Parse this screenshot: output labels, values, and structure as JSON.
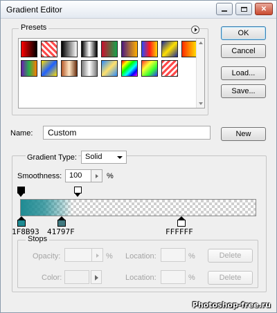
{
  "window": {
    "title": "Gradient Editor"
  },
  "buttons": {
    "ok": "OK",
    "cancel": "Cancel",
    "load": "Load...",
    "save": "Save...",
    "new": "New"
  },
  "presets": {
    "label": "Presets",
    "menu_icon": "right-arrow-circle-icon",
    "swatches": [
      "linear-gradient(90deg,#ff0000,#000000)",
      "repeating-linear-gradient(45deg,#ff4a4a 0 3px,#ffffff 3px 6px)",
      "linear-gradient(90deg,#000000,#ffffff)",
      "linear-gradient(90deg,#000000,#ffffff 50%,#000000)",
      "linear-gradient(90deg,#c8102e,#16a34a)",
      "linear-gradient(90deg,#4b1a7f,#ffb000)",
      "linear-gradient(90deg,#2a4bff,#ff1a1a,#ffd400)",
      "linear-gradient(135deg,#1b2a9a,#ffe000,#1b2a9a)",
      "linear-gradient(90deg,#ff2a00,#ffea00)",
      "linear-gradient(90deg,#6b1ab0,#2ab04b,#ff7a00)",
      "linear-gradient(135deg,#ffe000,#2060ff,#ffe000)",
      "linear-gradient(90deg,#b55a2a,#ffe7c6,#6b2f0f)",
      "linear-gradient(90deg,#7a7a7a,#ffffff,#7a7a7a)",
      "linear-gradient(135deg,#2a8cff,#ffe06a,#2a8cff)",
      "linear-gradient(135deg,#ff0000,#ffff00,#00ff00,#00ffff,#0000ff,#ff00ff)",
      "linear-gradient(135deg,rgba(255,0,0,.8),rgba(255,255,0,.8),rgba(0,255,0,.8),rgba(0,0,255,.8))",
      "repeating-linear-gradient(135deg,#ff4a4a 0 3px,#ffffff 3px 6px)"
    ]
  },
  "name": {
    "label": "Name:",
    "value": "Custom"
  },
  "gradient": {
    "type_label": "Gradient Type:",
    "type_value": "Solid",
    "smoothness_label": "Smoothness:",
    "smoothness_value": "100",
    "smoothness_unit": "%",
    "bar_start_color": "#1F8B93",
    "color_stops": [
      {
        "label": "1F8B93",
        "color": "#1F8B93"
      },
      {
        "label": "41797F",
        "color": "#41797F"
      },
      {
        "label": "FFFFFF",
        "color": "#FFFFFF"
      }
    ]
  },
  "stops": {
    "label": "Stops",
    "opacity_label": "Opacity:",
    "opacity_unit": "%",
    "location_label": "Location:",
    "location_unit": "%",
    "color_label": "Color:",
    "delete_label": "Delete"
  },
  "watermark": "Photoshop-free.ru"
}
